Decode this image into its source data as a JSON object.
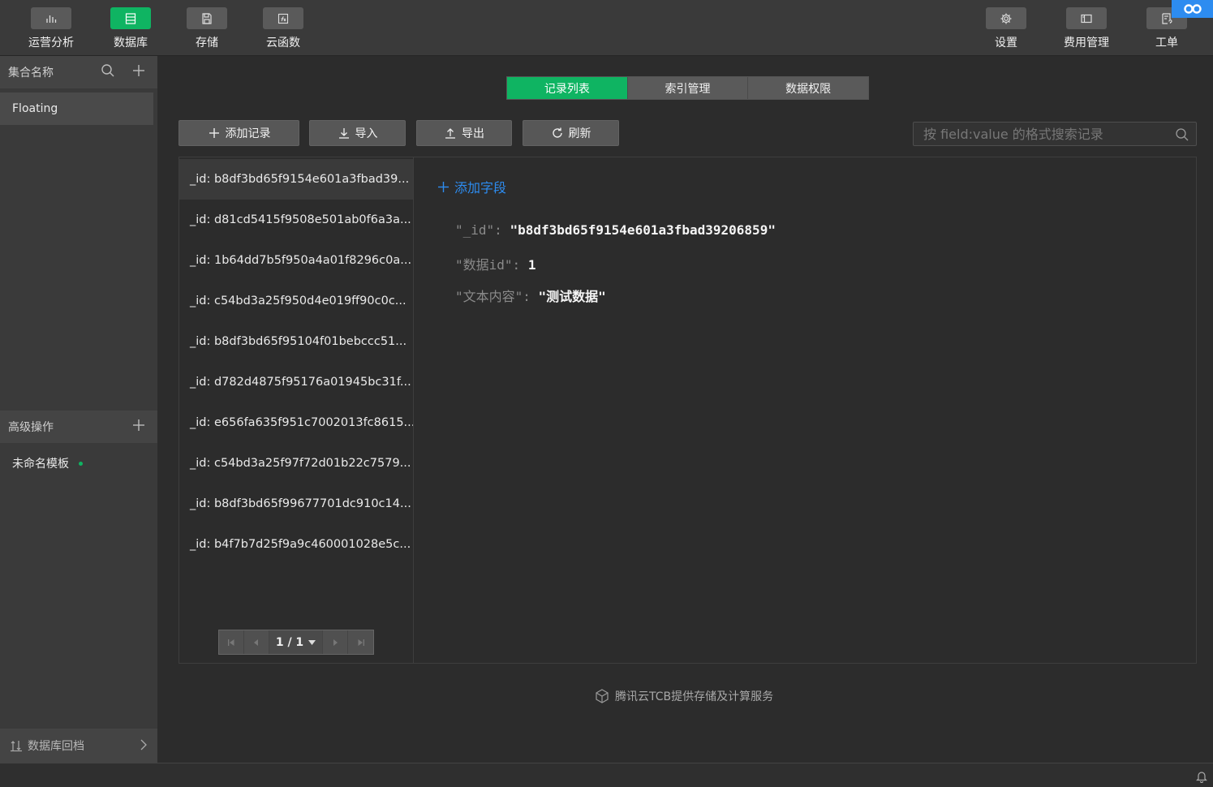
{
  "toolbar": {
    "left": [
      {
        "label": "运营分析",
        "icon": "bar-chart-icon"
      },
      {
        "label": "数据库",
        "icon": "database-icon"
      },
      {
        "label": "存储",
        "icon": "save-icon"
      },
      {
        "label": "云函数",
        "icon": "function-icon"
      }
    ],
    "right": [
      {
        "label": "设置",
        "icon": "gear-icon"
      },
      {
        "label": "费用管理",
        "icon": "billing-icon"
      },
      {
        "label": "工单",
        "icon": "ticket-icon"
      }
    ],
    "active": "数据库",
    "accent": "#0fb462"
  },
  "sidebar": {
    "collections_title": "集合名称",
    "collection": "Floating",
    "advanced_title": "高级操作",
    "template": "未命名模板",
    "rollback": "数据库回档"
  },
  "tabs": [
    "记录列表",
    "索引管理",
    "数据权限"
  ],
  "actions": {
    "add": "添加记录",
    "import": "导入",
    "export": "导出",
    "refresh": "刷新"
  },
  "search": {
    "placeholder": "按 field:value 的格式搜索记录"
  },
  "records": [
    "_id: b8df3bd65f9154e601a3fbad39...",
    "_id: d81cd5415f9508e501ab0f6a3a...",
    "_id: 1b64dd7b5f950a4a01f8296c0a...",
    "_id: c54bd3a25f950d4e019ff90c0c...",
    "_id: b8df3bd65f95104f01bebccc51...",
    "_id: d782d4875f95176a01945bc31f...",
    "_id: e656fa635f951c7002013fc8615...",
    "_id: c54bd3a25f97f72d01b22c7579...",
    "_id: b8df3bd65f99677701dc910c14...",
    "_id: b4f7b7d25f9a9c460001028e5c..."
  ],
  "pager": {
    "text": "1 / 1"
  },
  "detail": {
    "add_field": "添加字段",
    "fields": [
      {
        "key": "\"_id\": ",
        "value": "\"b8df3bd65f9154e601a3fbad39206859\""
      },
      {
        "key": "\"数据id\": ",
        "value": "1"
      },
      {
        "key": "\"文本内容\": ",
        "value": "\"测试数据\""
      }
    ]
  },
  "footer": "腾讯云TCB提供存储及计算服务"
}
